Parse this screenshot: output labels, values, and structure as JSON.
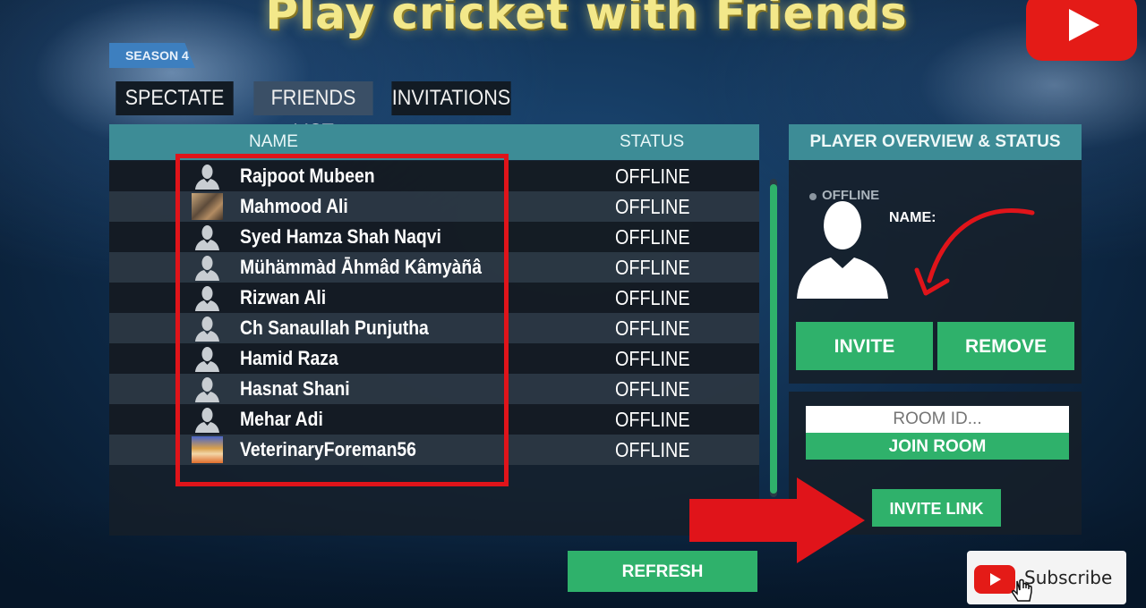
{
  "headline": "Play cricket with  Friends",
  "season_label": "SEASON 4",
  "tabs": [
    {
      "label": "SPECTATE",
      "active": false
    },
    {
      "label": "FRIENDS LIST",
      "active": true
    },
    {
      "label": "INVITATIONS",
      "active": false
    }
  ],
  "friends_table": {
    "col_name": "NAME",
    "col_status": "STATUS",
    "rows": [
      {
        "name": "Rajpoot Mubeen",
        "status": "OFFLINE",
        "avatar": "default-avatar"
      },
      {
        "name": "Mahmood Ali",
        "status": "OFFLINE",
        "avatar": "photo"
      },
      {
        "name": "Syed Hamza Shah Naqvi",
        "status": "OFFLINE",
        "avatar": "default-avatar"
      },
      {
        "name": "Mühämmàd Āhmâd Kâmyàñâ",
        "status": "OFFLINE",
        "avatar": "default-avatar"
      },
      {
        "name": "Rizwan Ali",
        "status": "OFFLINE",
        "avatar": "default-avatar"
      },
      {
        "name": "Ch Sanaullah Punjutha",
        "status": "OFFLINE",
        "avatar": "default-avatar"
      },
      {
        "name": "Hamid Raza",
        "status": "OFFLINE",
        "avatar": "default-avatar"
      },
      {
        "name": "Hasnat Shani",
        "status": "OFFLINE",
        "avatar": "default-avatar"
      },
      {
        "name": "Mehar Adi",
        "status": "OFFLINE",
        "avatar": "default-avatar"
      },
      {
        "name": "VeterinaryForeman56",
        "status": "OFFLINE",
        "avatar": "photo"
      }
    ]
  },
  "refresh_label": "REFRESH",
  "overview": {
    "title": "PLAYER OVERVIEW & STATUS",
    "status": "OFFLINE",
    "name_label": "NAME:",
    "invite_label": "INVITE",
    "remove_label": "REMOVE"
  },
  "room": {
    "placeholder": "ROOM ID...",
    "join_label": "JOIN ROOM",
    "invite_link_label": "INVITE LINK"
  },
  "subscribe_label": "Subscribe",
  "colors": {
    "accent_green": "#2fb16b",
    "header_teal": "#3d8c96",
    "highlight_red": "#e0141a",
    "headline_yellow": "#f3e88a"
  }
}
